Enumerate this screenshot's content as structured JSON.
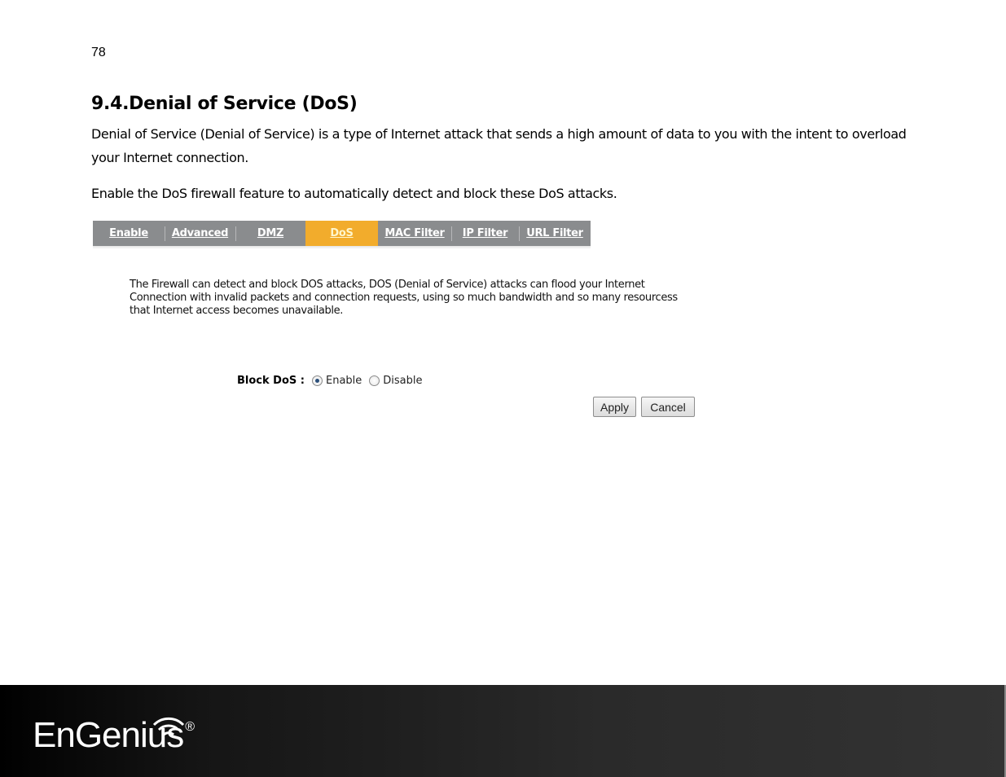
{
  "page": {
    "number": "78",
    "heading": "9.4.Denial of Service (DoS)",
    "paragraph1": "Denial of Service (Denial of Service) is a type of Internet attack that sends a high amount of data to you with the intent to overload your Internet connection.",
    "paragraph2": "Enable the DoS firewall feature to automatically detect and block these DoS attacks."
  },
  "screenshot": {
    "tabs": [
      {
        "label": "Enable",
        "active": false
      },
      {
        "label": "Advanced",
        "active": false
      },
      {
        "label": "DMZ",
        "active": false
      },
      {
        "label": "DoS",
        "active": true
      },
      {
        "label": "MAC Filter",
        "active": false
      },
      {
        "label": "IP Filter",
        "active": false
      },
      {
        "label": "URL Filter",
        "active": false
      }
    ],
    "description": "The Firewall can detect and block DOS attacks, DOS (Denial of Service) attacks can flood your Internet Connection with invalid packets and connection requests, using so much bandwidth and so many resourcess that Internet access becomes unavailable.",
    "block_dos": {
      "label": "Block DoS :",
      "options": [
        {
          "label": "Enable",
          "selected": true
        },
        {
          "label": "Disable",
          "selected": false
        }
      ]
    },
    "buttons": {
      "apply": "Apply",
      "cancel": "Cancel"
    },
    "colors": {
      "tab_bar": "#8a8c8e",
      "tab_active": "#f2ac2c"
    }
  },
  "footer": {
    "brand": "EnGenius",
    "registered_mark": "®",
    "logo_icon": "wifi-signal-icon"
  }
}
